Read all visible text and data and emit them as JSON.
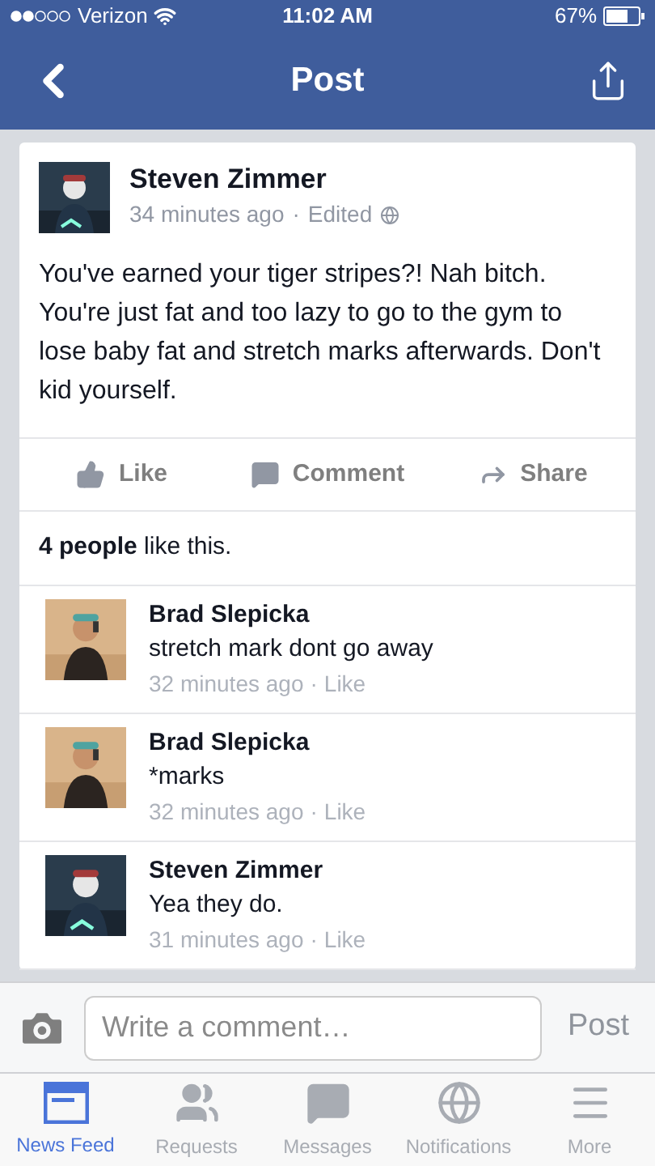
{
  "status_bar": {
    "carrier": "Verizon",
    "time": "11:02 AM",
    "battery": "67%"
  },
  "nav": {
    "title": "Post"
  },
  "post": {
    "author": "Steven Zimmer",
    "time": "34 minutes ago",
    "separator": "·",
    "edited": "Edited",
    "text": "You've earned your tiger stripes?! Nah bitch. You're just fat and too lazy to go to the gym to lose baby fat and stretch marks afterwards. Don't kid yourself.",
    "actions": [
      {
        "kind": "like",
        "label": "Like"
      },
      {
        "kind": "comment",
        "label": "Comment"
      },
      {
        "kind": "share",
        "label": "Share"
      }
    ],
    "likes": "**4 people** like this."
  },
  "comments": [
    {
      "author": "Brad Slepicka",
      "text": "stretch mark dont go away",
      "time": "32 minutes ago",
      "separator": "·",
      "like": "Like",
      "kind": "light"
    },
    {
      "author": "Brad Slepicka",
      "text": "*marks",
      "time": "32 minutes ago",
      "separator": "·",
      "like": "Like",
      "kind": "light"
    },
    {
      "author": "Steven Zimmer",
      "text": "Yea they do.",
      "time": "31 minutes ago",
      "separator": "·",
      "like": "Like",
      "kind": "dark"
    }
  ],
  "comment_bar": {
    "placeholder": "Write a comment…",
    "post": "Post"
  },
  "tabs": [
    {
      "kind": "feed",
      "label": "News Feed",
      "selected": true
    },
    {
      "kind": "requests",
      "label": "Requests",
      "selected": false
    },
    {
      "kind": "messages",
      "label": "Messages",
      "selected": false
    },
    {
      "kind": "notifications",
      "label": "Notifications",
      "selected": false
    },
    {
      "kind": "more",
      "label": "More",
      "selected": false
    }
  ]
}
